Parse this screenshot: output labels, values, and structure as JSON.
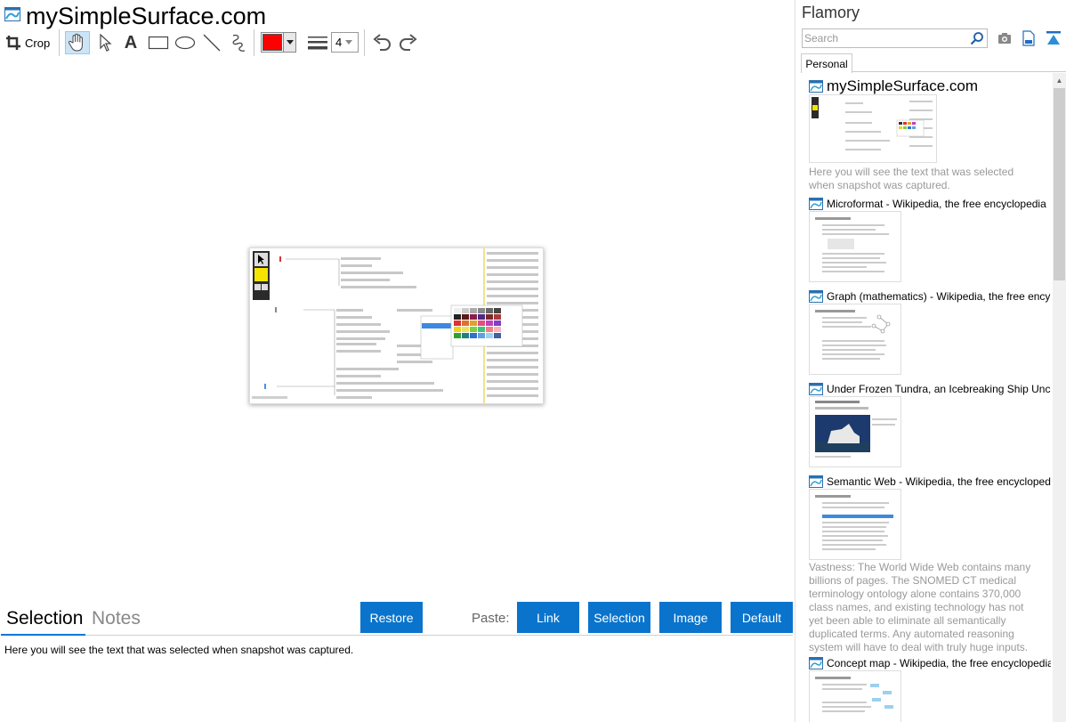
{
  "window": {
    "title": "mySimpleSurface.com"
  },
  "toolbar": {
    "crop_label": "Crop",
    "line_width_value": "4",
    "current_color": "#ff0000",
    "tools": [
      "hand-icon",
      "pointer-icon",
      "text-icon",
      "rectangle-icon",
      "ellipse-icon",
      "line-icon",
      "freehand-icon",
      "undo-icon",
      "redo-icon"
    ]
  },
  "bottom": {
    "tabs": [
      "Selection",
      "Notes"
    ],
    "restore_label": "Restore",
    "paste_label": "Paste:",
    "paste_buttons": [
      "Link",
      "Selection",
      "Image",
      "Default"
    ],
    "selection_text": "Here you will see the text that was selected when snapshot was captured."
  },
  "sidebar": {
    "app_name": "Flamory",
    "search_placeholder": "Search",
    "tab": "Personal",
    "entries": [
      {
        "title": "mySimpleSurface.com",
        "description": "Here you will see the text that was selected when snapshot was captured."
      },
      {
        "title": "Microformat - Wikipedia, the free encyclopedia",
        "description": ""
      },
      {
        "title": "Graph (mathematics) - Wikipedia, the free ency",
        "description": ""
      },
      {
        "title": "Under Frozen Tundra, an Icebreaking Ship Unco",
        "description": ""
      },
      {
        "title": "Semantic Web - Wikipedia, the free encycloped",
        "description": "Vastness: The World Wide Web contains many billions of pages. The SNOMED CT medical terminology ontology alone contains 370,000 class names, and existing technology has not yet been able to eliminate all semantically duplicated terms. Any automated reasoning system will have to deal with truly huge inputs."
      },
      {
        "title": "Concept map - Wikipedia, the free encyclopedia",
        "description": ""
      }
    ]
  },
  "colors": {
    "accent": "#0a74cc",
    "selected_tool": "#cce4f7"
  }
}
